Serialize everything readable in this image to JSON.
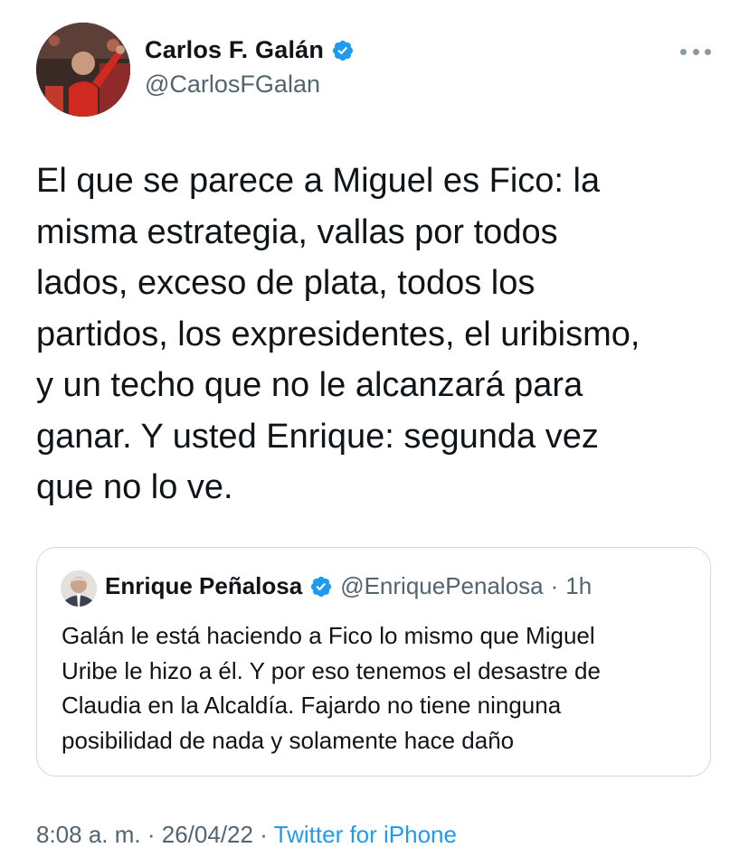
{
  "author": {
    "display_name": "Carlos F. Galán",
    "handle": "@CarlosFGalan",
    "verified": true
  },
  "tweet": {
    "text": "El que se parece a Miguel es Fico: la\nmisma estrategia, vallas por todos\nlados, exceso de plata, todos los\npartidos, los expresidentes, el uribismo,\ny un techo que no le alcanzará para\nganar. Y usted Enrique: segunda vez\nque no lo ve."
  },
  "quoted_tweet": {
    "display_name": "Enrique Peñalosa",
    "handle": "@EnriquePenalosa",
    "separator": "·",
    "time": "1h",
    "verified": true,
    "text": "Galán le está haciendo a Fico lo mismo que Miguel\nUribe le hizo a él. Y por eso tenemos el desastre de\nClaudia en la Alcaldía. Fajardo no tiene ninguna\nposibilidad de nada  y solamente hace daño"
  },
  "meta": {
    "time": "8:08 a. m.",
    "separator": "·",
    "date": "26/04/22",
    "separator2": "·",
    "source": "Twitter for iPhone"
  },
  "colors": {
    "accent": "#1d9bf0",
    "text_primary": "#0f1419",
    "text_secondary": "#536471",
    "border": "#cfd9de"
  },
  "icons": {
    "verified": "verified-badge-icon",
    "more": "more-horizontal-icon"
  }
}
